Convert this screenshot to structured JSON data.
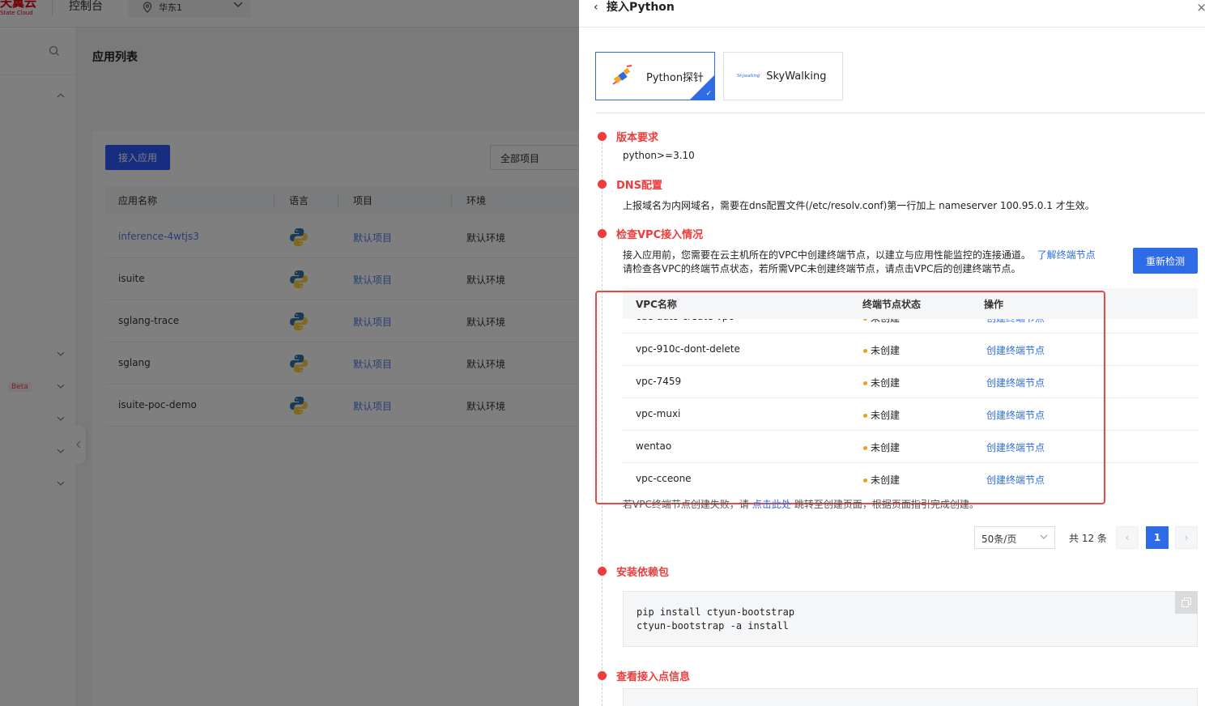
{
  "console": {
    "logo_text": "天翼云",
    "logo_sub": "State Cloud",
    "title": "控制台",
    "region": "华东1",
    "page_title": "应用列表",
    "connect_app_button": "接入应用",
    "filter_value": "全部项目",
    "beta_badge": "Beta",
    "table": {
      "headers": [
        "应用名称",
        "语言",
        "项目",
        "环境"
      ],
      "rows": [
        {
          "name": "inference-4wtjs3",
          "project": "默认项目",
          "env": "默认环境"
        },
        {
          "name": "isuite",
          "project": "默认项目",
          "env": "默认环境"
        },
        {
          "name": "sglang-trace",
          "project": "默认项目",
          "env": "默认环境"
        },
        {
          "name": "sglang",
          "project": "默认项目",
          "env": "默认环境"
        },
        {
          "name": "isuite-poc-demo",
          "project": "默认项目",
          "env": "默认环境"
        }
      ]
    }
  },
  "drawer": {
    "back_icon": "‹",
    "title": "接入Python",
    "close_icon": "×",
    "tabs": [
      {
        "label": "Python探针",
        "active": true
      },
      {
        "label": "SkyWalking",
        "logo_text": "Skywalking",
        "active": false
      }
    ],
    "steps": {
      "version": {
        "title": "版本要求",
        "text": "python>=3.10"
      },
      "dns": {
        "title": "DNS配置",
        "text": "上报域名为内网域名，需要在dns配置文件(/etc/resolv.conf)第一行加上 nameserver 100.95.0.1 才生效。"
      },
      "vpc": {
        "title": "检查VPC接入情况",
        "text1": "接入应用前，您需要在云主机所在的VPC中创建终端节点，以建立与应用性能监控的连接通道。",
        "text1_link": "了解终端节点",
        "text2": "请检查各VPC的终端节点状态，若所需VPC未创建终端节点，请点击VPC后的创建终端节点。",
        "recheck_button": "重新检测",
        "table_headers": [
          "VPC名称",
          "终端节点状态",
          "操作"
        ],
        "rows": [
          {
            "name": "cde-auto-create-vpc",
            "status": "未创建",
            "action": "创建终端节点"
          },
          {
            "name": "vpc-910c-dont-delete",
            "status": "未创建",
            "action": "创建终端节点"
          },
          {
            "name": "vpc-7459",
            "status": "未创建",
            "action": "创建终端节点"
          },
          {
            "name": "vpc-muxi",
            "status": "未创建",
            "action": "创建终端节点"
          },
          {
            "name": "wentao",
            "status": "未创建",
            "action": "创建终端节点"
          },
          {
            "name": "vpc-cceone",
            "status": "未创建",
            "action": "创建终端节点"
          }
        ],
        "note_before": "若VPC终端节点创建失败，请",
        "note_link": "点击此处",
        "note_after": "跳转至创建页面，根据页面指引完成创建。",
        "page_size": "50条/页",
        "total": "共 12 条",
        "current_page": "1",
        "prev_icon": "‹",
        "next_icon": "›"
      },
      "install": {
        "title": "安装依赖包",
        "code_line1": "pip install ctyun-bootstrap",
        "code_line2": "ctyun-bootstrap -a install"
      },
      "endpoint": {
        "title": "查看接入点信息"
      }
    }
  },
  "colors": {
    "accent": "#2e6be6",
    "step_red": "#ef3b3b",
    "highlight_box": "#e84a4a",
    "status_orange": "#f39c12"
  },
  "icons": [
    "location-pin-icon",
    "chevron-down-icon",
    "search-icon",
    "chevron-up-icon",
    "python-icon",
    "python-probe-logo-icon",
    "skywalking-logo-icon",
    "check-icon",
    "copy-icon",
    "chevron-left-icon",
    "close-icon"
  ]
}
